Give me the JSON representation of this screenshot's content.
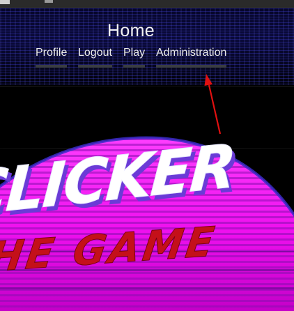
{
  "page": {
    "title": "Home"
  },
  "nav": {
    "items": [
      {
        "label": "Profile"
      },
      {
        "label": "Logout"
      },
      {
        "label": "Play"
      },
      {
        "label": "Administration"
      }
    ]
  },
  "logo": {
    "line1": "CLICKER",
    "line2": "THE GAME"
  },
  "colors": {
    "background": "#000000",
    "nav_text": "#ececec",
    "nav_underline": "#3a3d42",
    "logo_sun_top": "#ff33ff",
    "logo_sun_bottom": "#cc00cc",
    "logo_text_white": "#ffffff",
    "logo_text_shadow": "#6a3bd6",
    "logo_subtitle": "#c4101a",
    "annotation_arrow": "#e01010"
  }
}
